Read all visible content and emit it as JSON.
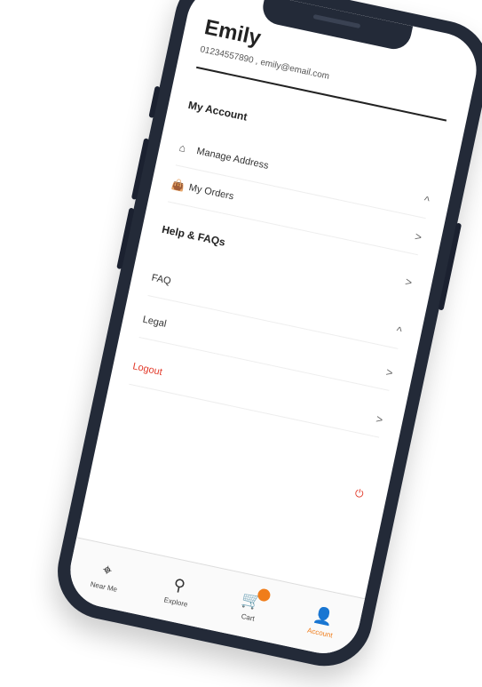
{
  "profile": {
    "name": "Emily",
    "phone": "01234557890",
    "separator": ",",
    "email": "emily@email.com"
  },
  "sections": {
    "account_title": "My Account",
    "help_title": "Help & FAQs"
  },
  "rows": {
    "manage_address": {
      "label": "Manage Address",
      "icon": "home-icon",
      "chevron": "^"
    },
    "my_orders": {
      "label": "My Orders",
      "icon": "bag-icon",
      "chevron": ">"
    },
    "help_chevron": ">",
    "faq": {
      "label": "FAQ",
      "chevron": "^"
    },
    "legal": {
      "label": "Legal",
      "chevron": ">"
    },
    "logout": {
      "label": "Logout",
      "chevron": ">"
    }
  },
  "tabbar": {
    "near_me": {
      "label": "Near Me",
      "icon": "location-pin-icon"
    },
    "explore": {
      "label": "Explore",
      "icon": "search-icon"
    },
    "cart": {
      "label": "Cart",
      "icon": "cart-icon"
    },
    "account": {
      "label": "Account",
      "icon": "user-icon"
    }
  },
  "colors": {
    "accent": "#f07d1a",
    "logout": "#e23a2a",
    "frame": "#232a38"
  }
}
